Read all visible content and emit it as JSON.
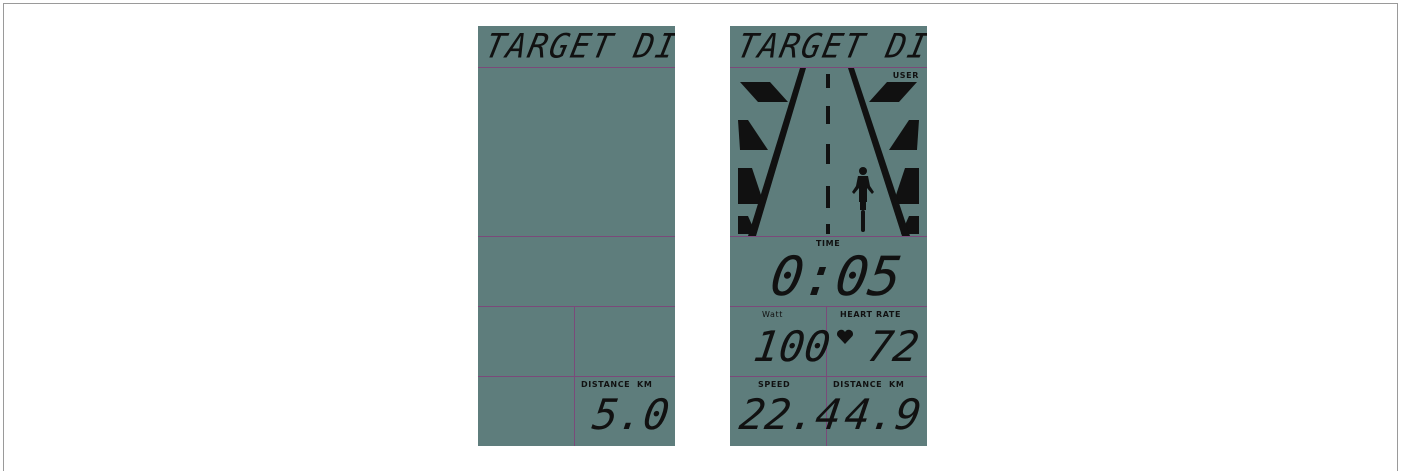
{
  "left_display": {
    "title": "TARGET DIST",
    "distance_label": "DISTANCE",
    "distance_unit": "KM",
    "distance_value": "5.0"
  },
  "right_display": {
    "title": "TARGET DIST",
    "user_label": "USER",
    "time_label": "TIME",
    "time_value": "0:05",
    "watt_label": "Watt",
    "watt_value": "100",
    "heart_rate_label": "HEART RATE",
    "heart_rate_value": "72",
    "speed_label": "SPEED",
    "speed_value": "22.4",
    "distance_label": "DISTANCE",
    "distance_unit": "KM",
    "distance_value": "4.9"
  },
  "icons": {
    "heart": "heart-icon",
    "cyclist": "cyclist-icon",
    "road": "road-scene"
  },
  "colors": {
    "lcd_background": "#5e7d7c",
    "segment": "#111111",
    "divider": "#7a4a7a"
  }
}
